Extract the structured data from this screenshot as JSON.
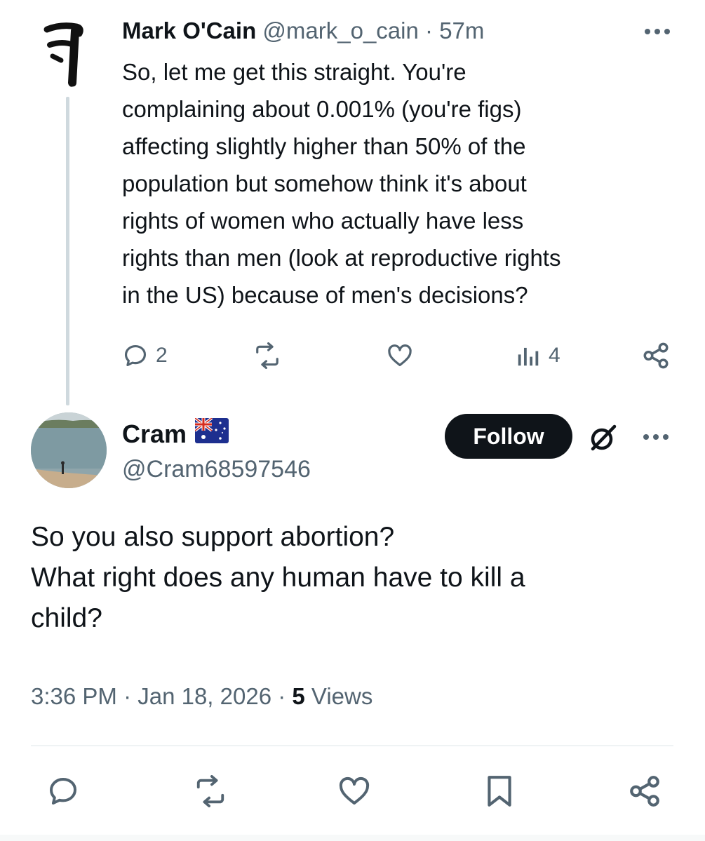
{
  "parent_tweet": {
    "display_name": "Mark O'Cain",
    "handle": "@mark_o_cain",
    "separator": "·",
    "time": "57m",
    "body": "So, let me get this straight. You're\ncomplaining about 0.001% (you're figs)\naffecting slightly higher than 50% of the\npopulation but somehow think it's about\nrights of women who actually have less\nrights than men (look at reproductive rights\nin the US) because of men's decisions?",
    "reply_count": "2",
    "view_count": "4"
  },
  "main_tweet": {
    "display_name": "Cram",
    "handle": "@Cram68597546",
    "follow_label": "Follow",
    "body": "So you also support abortion?\nWhat right does any human have to kill a\nchild?",
    "timestamp": "3:36 PM · Jan 18, 2026 · ",
    "views_count": "5",
    "views_label": " Views"
  },
  "colors": {
    "text_primary": "#0f1419",
    "text_secondary": "#536471",
    "thread_line": "#cfd9de",
    "divider": "#eff3f4",
    "follow_bg": "#0f1419",
    "follow_text": "#ffffff"
  },
  "icons": {
    "parent_avatar": "calligraphy-glyph",
    "main_avatar": "lake-photo",
    "flag": "australia-flag",
    "grok": "grok-icon"
  }
}
